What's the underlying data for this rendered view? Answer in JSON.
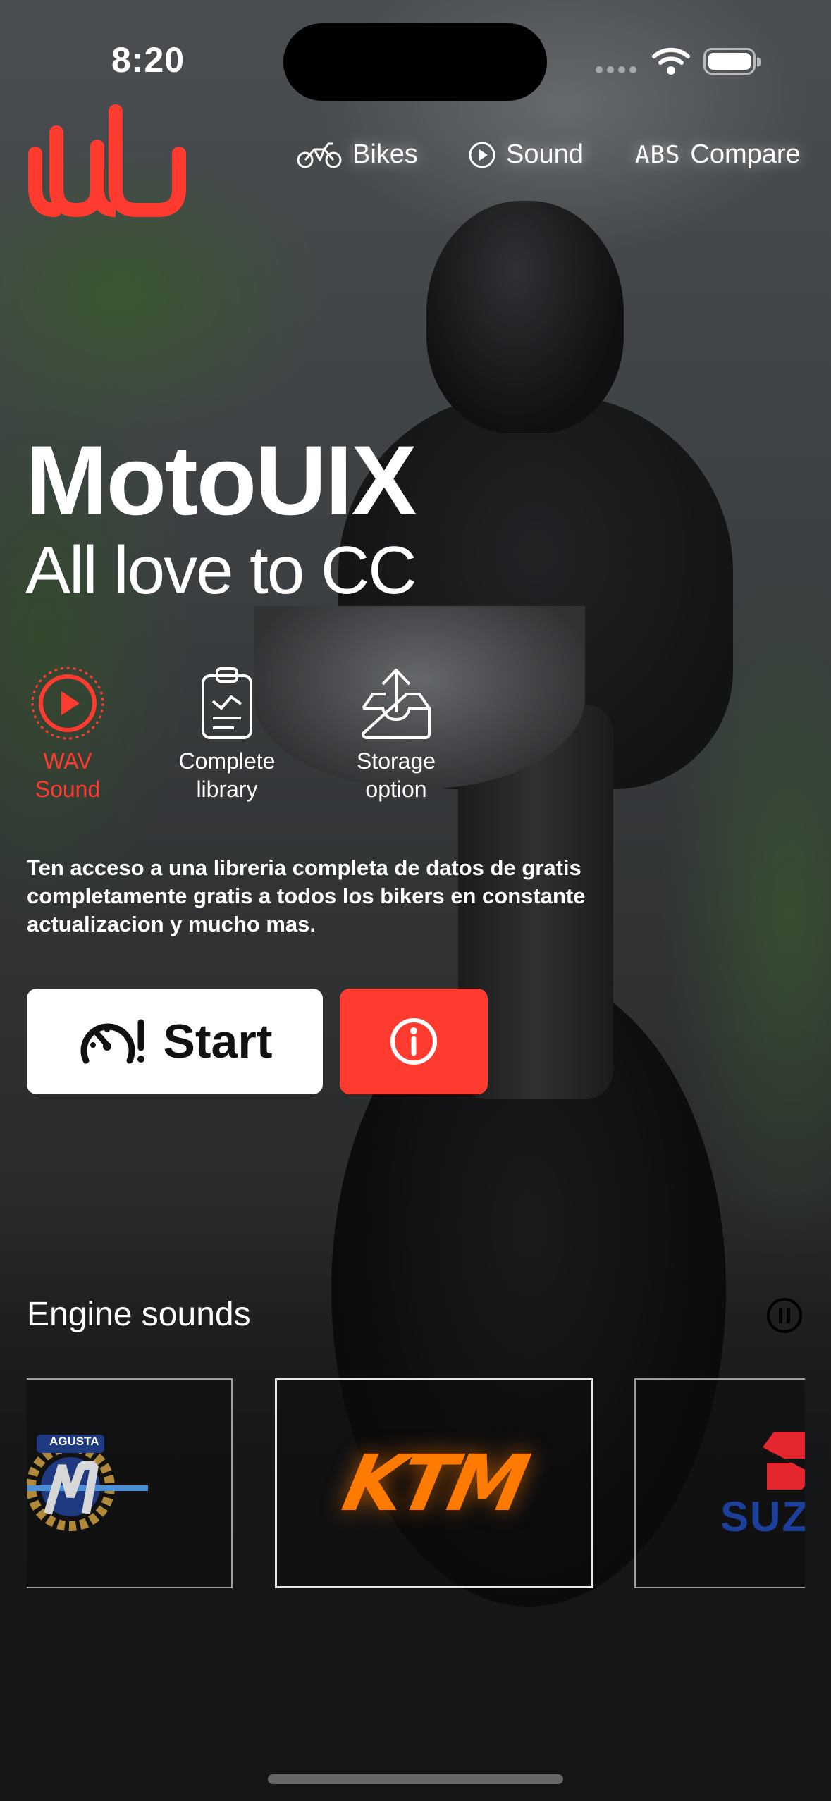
{
  "status_bar": {
    "time": "8:20"
  },
  "nav": {
    "items": [
      {
        "label": "Bikes",
        "icon": "motorcycle-icon"
      },
      {
        "label": "Sound",
        "icon": "play-circle-icon"
      },
      {
        "label": "Compare",
        "icon": "abs-icon",
        "icon_text": "ABS"
      }
    ]
  },
  "hero": {
    "title": "MotoUIX",
    "subtitle": "All love to CC"
  },
  "features": [
    {
      "line1": "WAV",
      "line2": "Sound",
      "icon": "play-circle-icon",
      "active": true
    },
    {
      "line1": "Complete",
      "line2": "library",
      "icon": "clipboard-check-icon"
    },
    {
      "line1": "Storage",
      "line2": "option",
      "icon": "tray-upload-icon"
    }
  ],
  "description": "Ten acceso a una libreria completa de datos de  gratis completamente gratis a todos los bikers en constante actualizacion y mucho mas.",
  "actions": {
    "start_label": "Start",
    "start_icon": "speedometer-alert-icon",
    "info_icon": "info-circle-icon"
  },
  "engine_sounds": {
    "title": "Engine sounds",
    "control_icon": "pause-circle-icon",
    "brands": [
      {
        "name": "MV Agusta",
        "logo_text": "AGUSTA"
      },
      {
        "name": "KTM",
        "logo_text": "KTM",
        "selected": true
      },
      {
        "name": "Suzuki",
        "logo_text": "SUZUKI"
      }
    ]
  },
  "colors": {
    "accent": "#ff3b30",
    "ktm_orange": "#ff7a00",
    "suzuki_blue": "#1c3f9c"
  }
}
